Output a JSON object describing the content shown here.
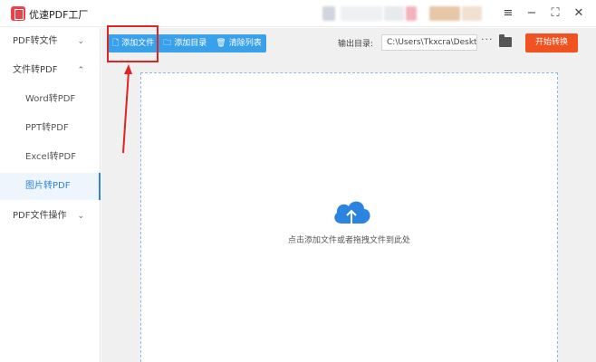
{
  "app": {
    "title": "优速PDF工厂"
  },
  "window": {
    "menu_icon": "hamburger-menu-icon",
    "minimize_icon": "minimize-icon",
    "maximize_icon": "maximize-icon",
    "close_icon": "close-icon"
  },
  "sidebar": {
    "groups": [
      {
        "label": "PDF转文件",
        "chevron": "⌄"
      },
      {
        "label": "文件转PDF",
        "chevron": "⌃"
      },
      {
        "label": "PDF文件操作",
        "chevron": "⌄"
      }
    ],
    "items": [
      {
        "label": "Word转PDF"
      },
      {
        "label": "PPT转PDF"
      },
      {
        "label": "Excel转PDF"
      },
      {
        "label": "图片转PDF",
        "active": true
      }
    ]
  },
  "toolbar": {
    "add_file_label": "添加文件",
    "add_folder_label": "添加目录",
    "clear_list_label": "清除列表",
    "output_label": "输出目录:",
    "output_path": "C:\\Users\\Tkxcra\\Desktop",
    "more_label": "···",
    "start_label": "开始转换"
  },
  "dropzone": {
    "hint": "点击添加文件或者拖拽文件到此处"
  },
  "colors": {
    "accent": "#2a84e0",
    "toolbar": "#39a0ea",
    "start": "#f0531f",
    "highlight": "#e02323"
  }
}
